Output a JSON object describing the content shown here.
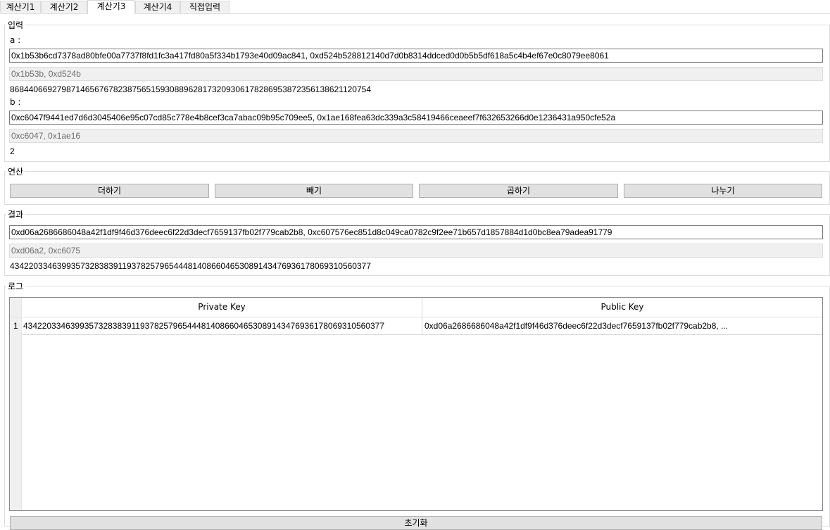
{
  "tabs": [
    "계산기1",
    "계산기2",
    "계산기3",
    "계산기4",
    "직접입력"
  ],
  "input": {
    "legend": "입력",
    "a_label": "a :",
    "a_value": "0x1b53b6cd7378ad80bfe00a7737f8fd1fc3a417fd80a5f334b1793e40d09ac841, 0xd524b528812140d7d0b8314ddced0d0b5b5df618a5c4b4ef67e0c8079ee8061",
    "a_short": "0x1b53b, 0xd524b",
    "a_decimal": "86844066927987146567678238756515930889628173209306178286953872356138621120754",
    "b_label": "b :",
    "b_value": "0xc6047f9441ed7d6d3045406e95c07cd85c778e4b8cef3ca7abac09b95c709ee5, 0x1ae168fea63dc339a3c58419466ceaeef7f632653266d0e1236431a950cfe52a",
    "b_short": "0xc6047, 0x1ae16",
    "b_decimal": "2"
  },
  "operation": {
    "legend": "연산",
    "buttons": [
      "더하기",
      "빼기",
      "곱하기",
      "나누기"
    ]
  },
  "result": {
    "legend": "결과",
    "value": "0xd06a2686686048a42f1df9f46d376deec6f22d3decf7659137fb02f779cab2b8, 0xc607576ec851d8c049ca0782c9f2ee71b657d1857884d1d0bc8ea79adea91779",
    "short": "0xd06a2, 0xc6075",
    "decimal": "43422033463993573283839119378257965444814086604653089143476936178069310560377"
  },
  "log": {
    "legend": "로그",
    "columns": [
      "Private Key",
      "Public Key"
    ],
    "rows": [
      {
        "index": "1",
        "private_key": "43422033463993573283839119378257965444814086604653089143476936178069310560377",
        "public_key": "0xd06a2686686048a42f1df9f46d376deec6f22d3decf7659137fb02f779cab2b8, ..."
      }
    ]
  },
  "bottom_button": "초기화"
}
